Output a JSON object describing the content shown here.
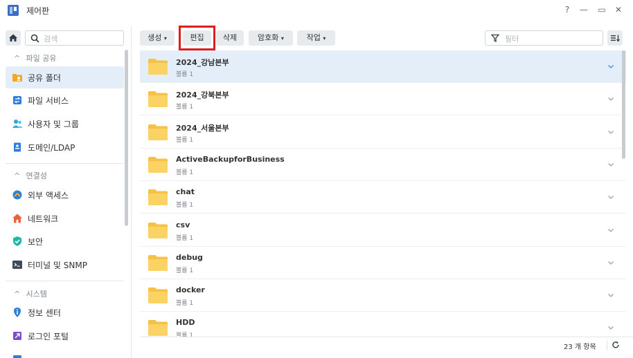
{
  "window": {
    "title": "제어판",
    "help_label": "?",
    "minimize_label": "—",
    "maximize_label": "▭",
    "close_label": "✕"
  },
  "sidebar": {
    "search_placeholder": "검색",
    "sections": [
      {
        "label": "파일 공유",
        "items": [
          {
            "label": "공유 폴더",
            "icon": "shared-folder-icon",
            "active": true
          },
          {
            "label": "파일 서비스",
            "icon": "file-services-icon",
            "active": false
          },
          {
            "label": "사용자 및 그룹",
            "icon": "user-group-icon",
            "active": false
          },
          {
            "label": "도메인/LDAP",
            "icon": "domain-ldap-icon",
            "active": false
          }
        ]
      },
      {
        "label": "연결성",
        "items": [
          {
            "label": "외부 액세스",
            "icon": "external-access-icon",
            "active": false
          },
          {
            "label": "네트워크",
            "icon": "network-icon",
            "active": false
          },
          {
            "label": "보안",
            "icon": "security-shield-icon",
            "active": false
          },
          {
            "label": "터미널 및 SNMP",
            "icon": "terminal-icon",
            "active": false
          }
        ]
      },
      {
        "label": "시스템",
        "items": [
          {
            "label": "정보 센터",
            "icon": "info-center-icon",
            "active": false
          },
          {
            "label": "로그인 포털",
            "icon": "login-portal-icon",
            "active": false
          }
        ]
      }
    ]
  },
  "toolbar": {
    "create_label": "생성",
    "edit_label": "편집",
    "delete_label": "삭제",
    "encrypt_label": "암호화",
    "action_label": "작업",
    "filter_placeholder": "필터"
  },
  "folders": [
    {
      "name": "2024_강남본부",
      "volume": "볼륨 1",
      "selected": true
    },
    {
      "name": "2024_강북본부",
      "volume": "볼륨 1",
      "selected": false
    },
    {
      "name": "2024_서울본부",
      "volume": "볼륨 1",
      "selected": false
    },
    {
      "name": "ActiveBackupforBusiness",
      "volume": "볼륨 1",
      "selected": false
    },
    {
      "name": "chat",
      "volume": "볼륨 1",
      "selected": false
    },
    {
      "name": "csv",
      "volume": "볼륨 1",
      "selected": false
    },
    {
      "name": "debug",
      "volume": "볼륨 1",
      "selected": false
    },
    {
      "name": "docker",
      "volume": "볼륨 1",
      "selected": false
    },
    {
      "name": "HDD",
      "volume": "볼륨 1",
      "selected": false
    }
  ],
  "footer": {
    "item_count": "23 개 항목"
  },
  "colors": {
    "accent": "#3a8fe0",
    "highlight_border": "#e01c1c",
    "folder_yellow": "#f7c244",
    "selected_row": "#e3eef9"
  }
}
